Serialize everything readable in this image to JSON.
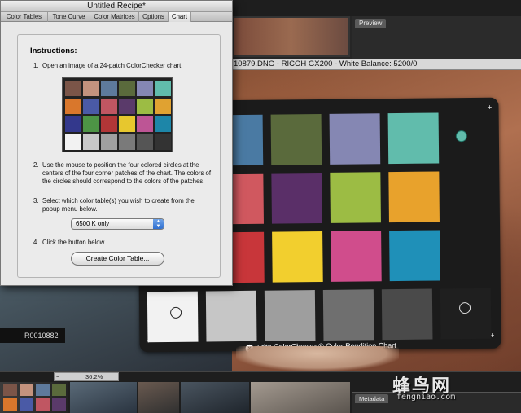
{
  "dialog": {
    "title": "Untitled Recipe*",
    "tabs": [
      "Color Tables",
      "Tone Curve",
      "Color Matrices",
      "Options",
      "Chart"
    ],
    "active_tab": "Chart",
    "instructions_title": "Instructions:",
    "steps": [
      {
        "num": "1.",
        "text": "Open an image of a 24-patch ColorChecker chart."
      },
      {
        "num": "2.",
        "text": "Use the mouse to position the four colored circles at the centers of the four corner patches of the chart. The colors of the circles should correspond to the colors of the patches."
      },
      {
        "num": "3.",
        "text": "Select which color table(s) you wish to create from the popup menu below."
      },
      {
        "num": "4.",
        "text": "Click the button below."
      }
    ],
    "popup_value": "6500 K only",
    "button_label": "Create Color Table...",
    "mini_chart_colors": [
      [
        "#7b5548",
        "#c4937e",
        "#5e7a9c",
        "#5a6a3c",
        "#8587b3",
        "#61bcac"
      ],
      [
        "#d9772c",
        "#4a5aa6",
        "#c05662",
        "#5a3a6a",
        "#9cbc44",
        "#e0a231"
      ],
      [
        "#33388c",
        "#4d9445",
        "#b23637",
        "#e7c72e",
        "#bd5595",
        "#1d86a8"
      ],
      [
        "#f2f2f2",
        "#c8c8c8",
        "#a0a0a0",
        "#7a7a7a",
        "#555555",
        "#333333"
      ]
    ]
  },
  "image_info": {
    "filename_text": "10879.DNG  -  RICOH GX200  -  White Balance: 5200/0"
  },
  "panels": {
    "preview_tab": "Preview",
    "metadata_tab": "Metadata"
  },
  "thumbnail_label": "R0010882",
  "zoom": {
    "minus": "−",
    "value": "36.2%"
  },
  "checker": {
    "caption_logo": "x",
    "caption_brand": "x·rite",
    "caption_rest": " ColorChecker® Color Rendition Chart",
    "colors": [
      [
        "#c4937e",
        "#4a7aa3",
        "#5a6a3c",
        "#8587b3",
        "#61bcac"
      ],
      [
        "#4a5aa6",
        "#d0585f",
        "#5a2f68",
        "#9cbc44",
        "#e8a22c"
      ],
      [
        "#4d9445",
        "#c8363a",
        "#f2cf2e",
        "#d04d8c",
        "#1f90b8"
      ],
      [
        "#f2f2f2",
        "#c6c6c6",
        "#9e9e9e",
        "#6f6f6f",
        "#4a4a4a",
        "#1f1f1f"
      ]
    ],
    "marker_colors": {
      "top_right": "#61bcac",
      "bottom_left": "#222222",
      "bottom_right": "#dddddd"
    }
  },
  "watermark": {
    "text": "蜂鸟网",
    "url": "fengniao.com"
  },
  "colors": {
    "accent": "#2f6fd0",
    "dialog_bg": "#e8e8e8"
  }
}
